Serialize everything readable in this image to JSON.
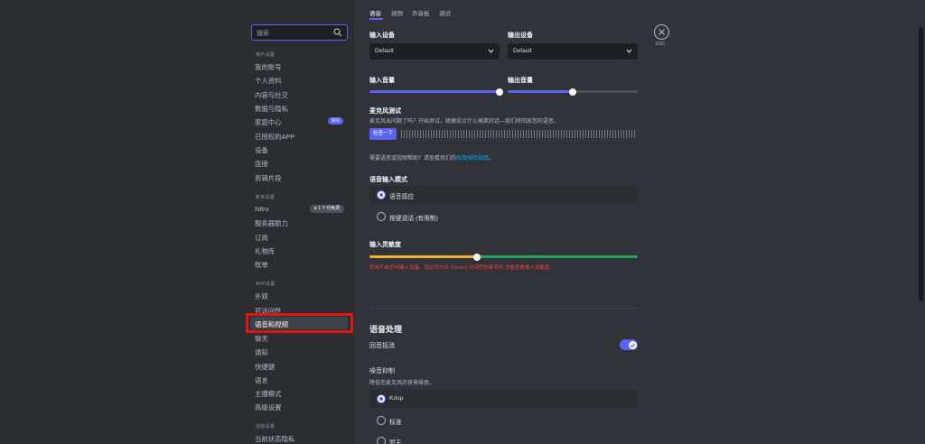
{
  "sidebar": {
    "search_placeholder": "搜索",
    "sections": [
      {
        "header": "用户设置",
        "items": [
          "我的账号",
          "个人资料",
          "内容与社交",
          "数据与隐私",
          "家庭中心",
          "已授权的APP",
          "设备",
          "连接",
          "剪辑片段"
        ]
      },
      {
        "header": "账单设置",
        "items": [
          "Nitro",
          "服务器助力",
          "订阅",
          "礼物库",
          "账单"
        ]
      },
      {
        "header": "APP设置",
        "items": [
          "外观",
          "可访问性",
          "语音和视频",
          "聊天",
          "通知",
          "快捷键",
          "语言",
          "主播模式",
          "高级设置"
        ]
      },
      {
        "header": "活动设置",
        "items": [
          "当前状态隐私"
        ]
      }
    ],
    "family_badge": "新的",
    "nitro_badge": "1 个月免费",
    "active_item": "语音和视频"
  },
  "tabs": [
    "语音",
    "视频",
    "声音板",
    "调试"
  ],
  "active_tab": "语音",
  "close_label": "ESC",
  "voice": {
    "input_device_label": "输入设备",
    "output_device_label": "输出设备",
    "input_device_value": "Default",
    "output_device_value": "Default",
    "input_volume_label": "输入音量",
    "output_volume_label": "输出音量",
    "input_volume": 1.0,
    "output_volume": 0.5,
    "mic_test_title": "麦克风测试",
    "mic_test_desc": "麦克风出问题了吗？开始测试，随便说点什么搞笑的话—我们将回放您的语音。",
    "mic_test_button": "检查一下",
    "help_text": "需要语音或视频帮助？请查看我们的",
    "help_link": "故障排除指南",
    "help_suffix": "。",
    "input_mode_label": "语音输入模式",
    "mode_options": [
      "语音感应",
      "按键说话 (有限制)"
    ],
    "mode_selected": "语音感应",
    "sensitivity_label": "输入灵敏度",
    "sensitivity_value": 0.4,
    "warning": "您未开启任何输入设备。您必须允许 Discord 访问您的麦克风 才能查看输入灵敏度。"
  },
  "processing": {
    "title": "语音处理",
    "echo_label": "回音抵消",
    "echo_enabled": true,
    "noise_label": "噪音抑制",
    "noise_desc": "降低您麦克风的背景噪音。",
    "noise_options": [
      "Krisp",
      "标准",
      "暂无"
    ],
    "noise_selected": "Krisp"
  },
  "colors": {
    "accent": "#5865f2",
    "danger": "#f23f43",
    "highlight_box": "#e01515"
  }
}
